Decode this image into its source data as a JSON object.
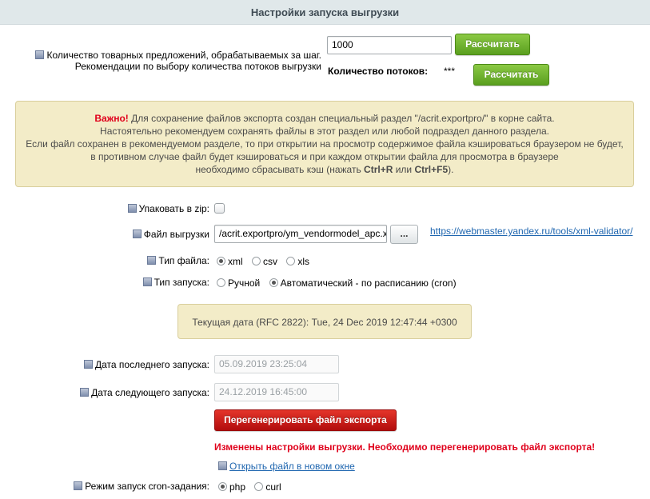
{
  "header": {
    "title": "Настройки запуска выгрузки"
  },
  "offers": {
    "label_line1": "Количество товарных предложений, обрабатываемых за шаг.",
    "label_line2": "Рекомендации по выбору количества потоков выгрузки",
    "value": "1000",
    "calc_button": "Рассчитать",
    "threads_label": "Количество потоков:",
    "threads_value": "***",
    "threads_button": "Рассчитать"
  },
  "notice": {
    "important": "Важно!",
    "line1": " Для сохранение файлов экспорта создан специальный раздел \"/acrit.exportpro/\" в корне сайта.",
    "line2": "Настоятельно рекомендуем сохранять файлы в этот раздел или любой подраздел данного раздела.",
    "line3": "Если файл сохранен в рекомендуемом разделе, то при открытии на просмотр содержимое файла кэшироваться браузером не будет,",
    "line4": "в противном случае файл будет кэшироваться и при каждом открытии файла для просмотра в браузере",
    "line5_pre": "необходимо сбрасывать кэш (нажать ",
    "key1": "Ctrl+R",
    "or": " или ",
    "key2": "Ctrl+F5",
    "line5_post": ")."
  },
  "zip": {
    "label": "Упаковать в zip:",
    "checked": false
  },
  "file": {
    "label": "Файл выгрузки",
    "value": "/acrit.exportpro/ym_vendormodel_apc.x",
    "browse": "...",
    "validator_link": "https://webmaster.yandex.ru/tools/xml-validator/"
  },
  "file_type": {
    "label": "Тип файла:",
    "options": [
      "xml",
      "csv",
      "xls"
    ],
    "selected": "xml"
  },
  "launch_type": {
    "label": "Тип запуска:",
    "options": [
      "Ручной",
      "Автоматический - по расписанию (cron)"
    ],
    "selected": "Автоматический - по расписанию (cron)"
  },
  "current_date": {
    "text": "Текущая дата (RFC 2822): Tue, 24 Dec 2019 12:47:44 +0300"
  },
  "last_run": {
    "label": "Дата последнего запуска:",
    "value": "05.09.2019 23:25:04"
  },
  "next_run": {
    "label": "Дата следующего запуска:",
    "value": "24.12.2019 16:45:00"
  },
  "regen": {
    "button": "Перегенерировать файл экспорта",
    "warning": "Изменены настройки выгрузки. Необходимо перегенерировать файл экспорта!",
    "open_link": "Открыть файл в новом окне"
  },
  "cron_mode": {
    "label": "Режим запуск cron-задания:",
    "options": [
      "php",
      "curl"
    ],
    "selected": "php"
  },
  "colors": {
    "header_bg": "#e0e8ea",
    "green_button": "#6fb22f",
    "red_button": "#c81a14",
    "notice_bg": "#f3ecc8",
    "warning_text": "#e0001b",
    "link": "#2067b0"
  }
}
